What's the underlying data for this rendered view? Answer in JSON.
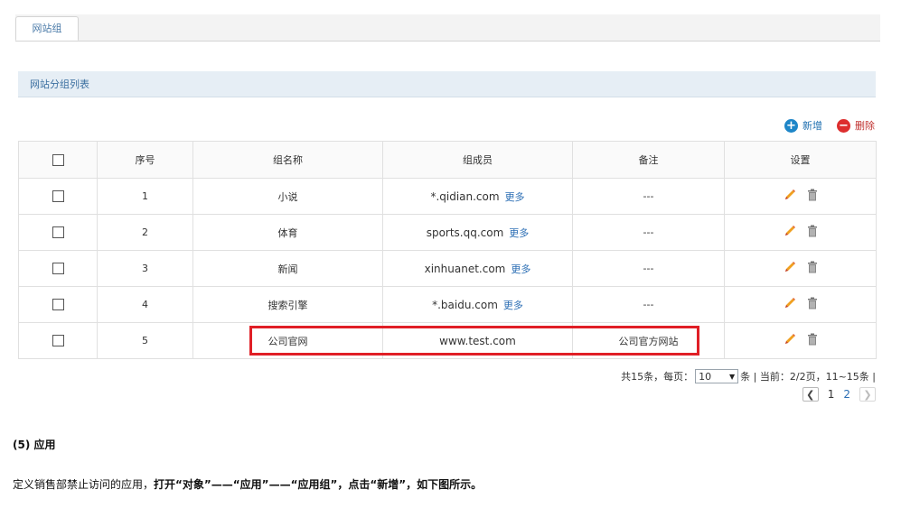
{
  "tabs": [
    {
      "label": "网站组"
    }
  ],
  "section": {
    "title": "网站分组列表"
  },
  "toolbar": {
    "add_label": "新增",
    "delete_label": "删除"
  },
  "table": {
    "headers": [
      "序号",
      "组名称",
      "组成员",
      "备注",
      "设置"
    ],
    "rows": [
      {
        "index": "1",
        "name": "小说",
        "members": "*.qidian.com",
        "more": "更多",
        "note": "---"
      },
      {
        "index": "2",
        "name": "体育",
        "members": "sports.qq.com",
        "more": "更多",
        "note": "---"
      },
      {
        "index": "3",
        "name": "新闻",
        "members": "xinhuanet.com",
        "more": "更多",
        "note": "---"
      },
      {
        "index": "4",
        "name": "搜索引擎",
        "members": "*.baidu.com",
        "more": "更多",
        "note": "---"
      },
      {
        "index": "5",
        "name": "公司官网",
        "members": "www.test.com",
        "more": "",
        "note": "公司官方网站"
      }
    ]
  },
  "pager": {
    "total_text": "共15条，每页：",
    "page_size": "10",
    "suffix_text": "条 | 当前：2/2页，11~15条 |",
    "pages": [
      "1",
      "2"
    ],
    "current_page": "2"
  },
  "doc": {
    "heading": "(5) 应用",
    "para_plain": "定义销售部禁止访问的应用，",
    "para_bold": "打开“对象”——“应用”——“应用组”，点击“新增”，如下图所示。"
  },
  "colors": {
    "accent": "#1e86c8",
    "danger": "#dd2e2e",
    "highlight": "#e01f26",
    "link": "#2b6eb4"
  }
}
